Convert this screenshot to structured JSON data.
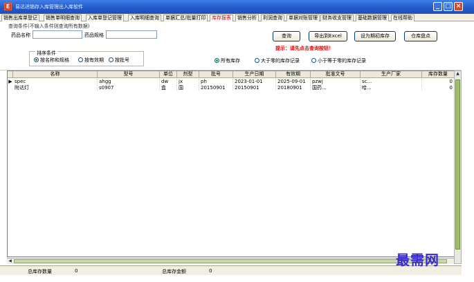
{
  "window": {
    "title": "易达进销存入库管理出入库软件",
    "app_icon": "E",
    "min_icon": "minimize-icon",
    "max_icon": "maximize-icon",
    "close_icon": "close-icon"
  },
  "tabs": [
    {
      "label": "销售出库单登记"
    },
    {
      "label": "销售单明细查询"
    },
    {
      "label": "入库单登记管理"
    },
    {
      "label": "入库明细查询"
    },
    {
      "label": "单据汇总/批量打印"
    },
    {
      "label": "库存报表"
    },
    {
      "label": "销售分析"
    },
    {
      "label": "利润查询"
    },
    {
      "label": "单据对账管理"
    },
    {
      "label": "财务收支管理"
    },
    {
      "label": "基础数据管理"
    },
    {
      "label": "在线帮助"
    }
  ],
  "query": {
    "group_label": "查询条件(不输入条件则查询所有数据)",
    "drug_name_label": "药品名称",
    "drug_name_value": "",
    "drug_spec_label": "药品规格",
    "drug_spec_value": "",
    "query_button": "查询",
    "export_button": "导出到Excel",
    "save_period_button": "设为期初库存",
    "stocktake_button": "仓库盘点",
    "hint": "提示：请先点击查询按钮！",
    "sort_label": "排序条件",
    "sort_options": [
      "按名称和规格",
      "按有效期",
      "按批号"
    ],
    "sort_selected": "按名称和规格",
    "stock_filters": [
      "所有库存",
      "大于零的库存记录",
      "小于等于零的库存记录"
    ],
    "stock_selected": "所有库存"
  },
  "table": {
    "columns": [
      "名称",
      "型号",
      "单位",
      "剂型",
      "批号",
      "生产日期",
      "有效期",
      "批准文号",
      "生产厂家",
      "库存数量"
    ],
    "rows": [
      [
        "spec",
        "ahgg",
        "dw",
        "jx",
        "ph",
        "2023-01-01",
        "2025-09-01",
        "pzwj",
        "sc...",
        "0"
      ],
      [
        "附达灯",
        "s0907",
        "盒",
        "国",
        "20150901",
        "20150901",
        "20180901",
        "国药...",
        "哈...",
        "0"
      ]
    ]
  },
  "status": {
    "total_qty_label": "总库存数量",
    "total_qty_value": "0",
    "total_amount_label": "总库存金额",
    "total_amount_value": "0"
  },
  "watermark": "最需网",
  "colors": {
    "titlebar": "#2358c9",
    "hint": "#e00000",
    "active_tab": "#cc0000",
    "watermark": "#3a2ad0"
  }
}
